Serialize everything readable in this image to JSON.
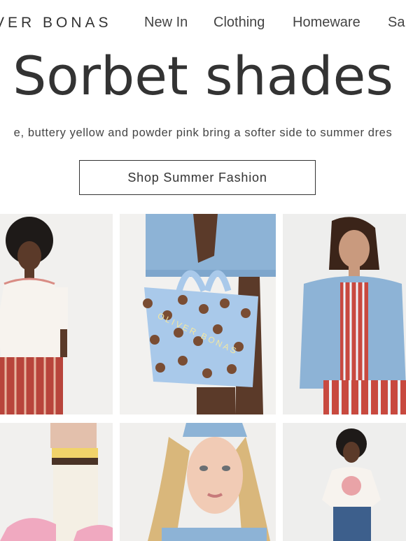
{
  "header": {
    "logo": "VER BONAS",
    "nav": [
      "New In",
      "Clothing",
      "Homeware",
      "Sa"
    ]
  },
  "hero": {
    "title": "Sorbet shades",
    "subtitle": "e, buttery yellow and powder pink bring a softer side to summer dres",
    "cta": "Shop Summer Fashion"
  },
  "bag": {
    "brand_text": "OLIVER BONAS"
  },
  "colors": {
    "text": "#333333",
    "bag_blue": "#a9c9ea",
    "dots": "#7a4d33",
    "denim": "#8db3d6",
    "stripe_red": "#c8493f"
  }
}
